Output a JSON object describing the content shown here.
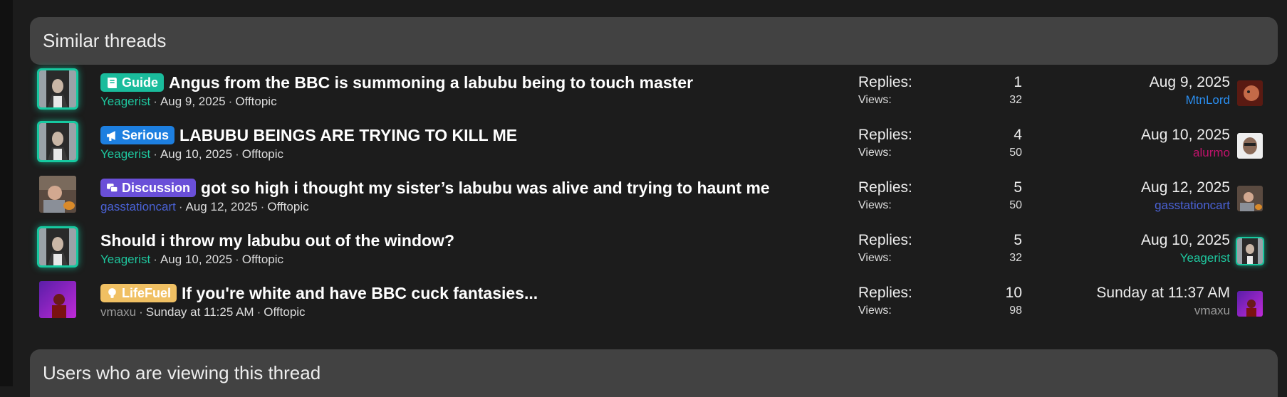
{
  "similar": {
    "title": "Similar threads"
  },
  "viewing": {
    "title": "Users who are viewing this thread"
  },
  "labels": {
    "replies": "Replies:",
    "views": "Views:"
  },
  "colors": {
    "guide": "#1abc9c",
    "serious": "#1d7fe0",
    "discussion": "#6a4fd8",
    "lifefuel": "#f0c063"
  },
  "threads": [
    {
      "prefix": "Guide",
      "prefix_icon": "book-icon",
      "title": "Angus from the BBC is summoning a labubu being to touch master",
      "author": "Yeagerist",
      "date": "Aug 9, 2025",
      "forum": "Offtopic",
      "replies": "1",
      "views": "32",
      "last_date": "Aug 9, 2025",
      "last_user": "MtnLord"
    },
    {
      "prefix": "Serious",
      "prefix_icon": "megaphone-icon",
      "title": "LABUBU BEINGS ARE TRYING TO KILL ME",
      "author": "Yeagerist",
      "date": "Aug 10, 2025",
      "forum": "Offtopic",
      "replies": "4",
      "views": "50",
      "last_date": "Aug 10, 2025",
      "last_user": "alurmo"
    },
    {
      "prefix": "Discussion",
      "prefix_icon": "chat-icon",
      "title": "got so high i thought my sister’s labubu was alive and trying to haunt me",
      "author": "gasstationcart",
      "date": "Aug 12, 2025",
      "forum": "Offtopic",
      "replies": "5",
      "views": "50",
      "last_date": "Aug 12, 2025",
      "last_user": "gasstationcart"
    },
    {
      "prefix": "",
      "prefix_icon": "",
      "title": "Should i throw my labubu out of the window?",
      "author": "Yeagerist",
      "date": "Aug 10, 2025",
      "forum": "Offtopic",
      "replies": "5",
      "views": "32",
      "last_date": "Aug 10, 2025",
      "last_user": "Yeagerist"
    },
    {
      "prefix": "LifeFuel",
      "prefix_icon": "lightbulb-icon",
      "title": "If you're white and have BBC cuck fantasies...",
      "author": "vmaxu",
      "date": "Sunday at 11:25 AM",
      "forum": "Offtopic",
      "replies": "10",
      "views": "98",
      "last_date": "Sunday at 11:37 AM",
      "last_user": "vmaxu"
    }
  ]
}
